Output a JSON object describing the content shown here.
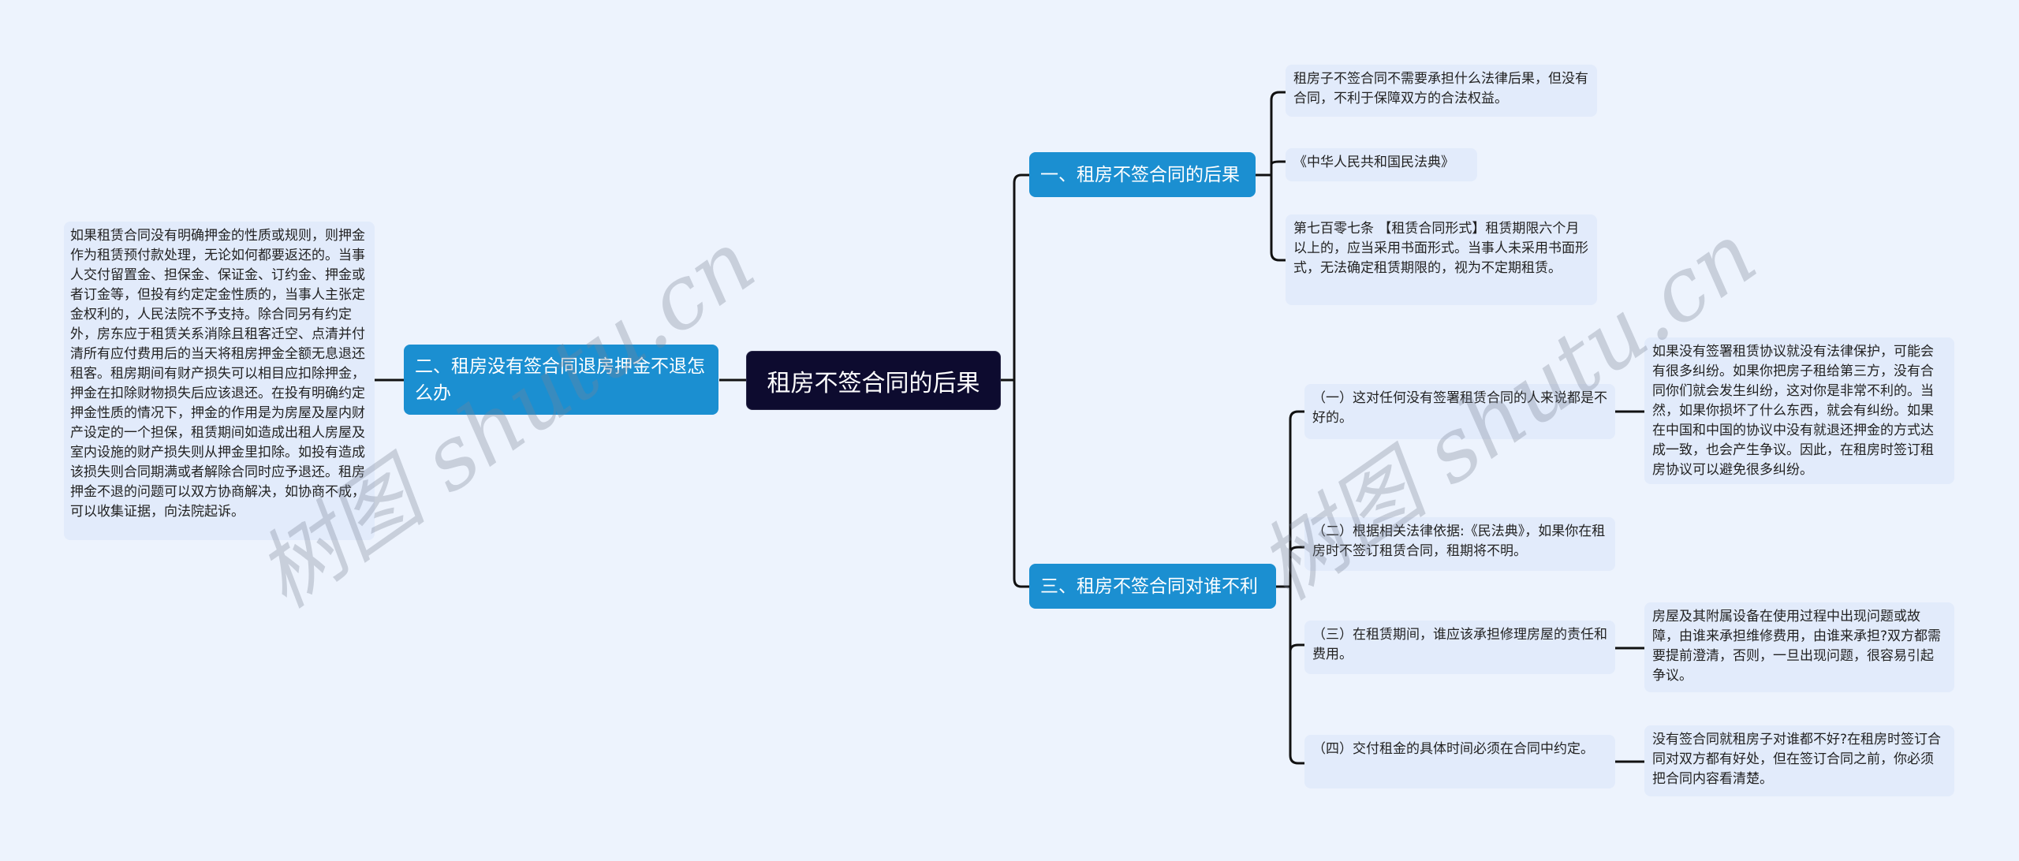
{
  "root": {
    "label": "租房不签合同的后果"
  },
  "branches": [
    {
      "label": "一、租房不签合同的后果",
      "children": [
        {
          "text": "租房子不签合同不需要承担什么法律后果，但没有合同，不利于保障双方的合法权益。"
        },
        {
          "text": "《中华人民共和国民法典》"
        },
        {
          "text": "第七百零七条 【租赁合同形式】租赁期限六个月以上的，应当采用书面形式。当事人未采用书面形式，无法确定租赁期限的，视为不定期租赁。"
        }
      ]
    },
    {
      "label": "二、租房没有签合同退房押金不退怎么办",
      "children": [
        {
          "text": "如果租赁合同没有明确押金的性质或规则，则押金作为租赁预付款处理，无论如何都要返还的。当事人交付留置金、担保金、保证金、订约金、押金或者订金等，但投有约定定金性质的，当事人主张定金权利的，人民法院不予支持。除合同另有约定外，房东应于租赁关系消除且租客迁空、点清并付清所有应付费用后的当天将租房押金全额无息退还租客。租房期间有财产损失可以相目应扣除押金，押金在扣除财物损失后应该退还。在投有明确约定押金性质的情况下，押金的作用是为房屋及屋内财产设定的一个担保，租赁期间如造成出租人房屋及室内设施的财产损失则从押金里扣除。如投有造成该损失则合同期满或者解除合同时应予退还。租房押金不退的问题可以双方协商解决，如协商不成，可以收集证据，向法院起诉。"
        }
      ]
    },
    {
      "label": "三、租房不签合同对谁不利",
      "children": [
        {
          "text": "（一）这对任何没有签署租赁合同的人来说都是不好的。",
          "detail": "如果没有签署租赁协议就没有法律保护，可能会有很多纠纷。如果你把房子租给第三方，没有合同你们就会发生纠纷，这对你是非常不利的。当然，如果你损坏了什么东西，就会有纠纷。如果在中国和中国的协议中没有就退还押金的方式达成一致，也会产生争议。因此，在租房时签订租房协议可以避免很多纠纷。"
        },
        {
          "text": "（二）根据相关法律依据:《民法典》，如果你在租房时不签订租赁合同，租期将不明。"
        },
        {
          "text": "（三）在租赁期间，谁应该承担修理房屋的责任和费用。",
          "detail": "房屋及其附属设备在使用过程中出现问题或故障，由谁来承担维修费用，由谁来承担?双方都需要提前澄清，否则，一旦出现问题，很容易引起争议。"
        },
        {
          "text": "（四）交付租金的具体时间必须在合同中约定。",
          "detail": "没有签合同就租房子对谁都不好?在租房时签订合同对双方都有好处，但在签订合同之前，你必须把合同内容看清楚。"
        }
      ]
    }
  ],
  "watermark": {
    "text": "树图 shutu.cn"
  },
  "colors": {
    "root_bg": "#0d0b2f",
    "branch_bg": "#1b8fd1",
    "leaf_bg": "#e2ebfb",
    "canvas_bg": "#edf3fd",
    "line": "#111111"
  }
}
